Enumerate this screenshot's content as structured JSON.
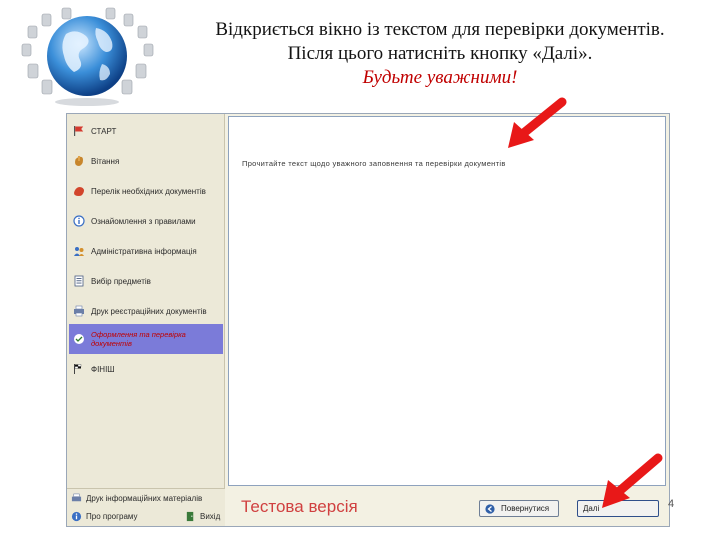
{
  "header": {
    "line1": "Відкриється вікно із текстом для перевірки документів.",
    "line2": "Після цього натисніть кнопку «Далі».",
    "line3": "Будьте уважними!"
  },
  "sidebar": {
    "items": [
      {
        "label": "СТАРТ",
        "icon": "flag-icon"
      },
      {
        "label": "Вітання",
        "icon": "hand-icon"
      },
      {
        "label": "Перелік необхідних документів",
        "icon": "hand-icon"
      },
      {
        "label": "Ознайомлення з правилами",
        "icon": "info-icon"
      },
      {
        "label": "Адміністративна інформація",
        "icon": "people-icon"
      },
      {
        "label": "Вибір предметів",
        "icon": "list-icon"
      },
      {
        "label": "Друк реєстраційних документів",
        "icon": "printer-icon"
      },
      {
        "label": "Оформлення та перевірка документів",
        "icon": "document-check-icon"
      },
      {
        "label": "ФІНІШ",
        "icon": "checkered-flag-icon"
      }
    ]
  },
  "content": {
    "text": "Прочитайте текст щодо уважного заповнення та перевірки документів"
  },
  "bottom_left": {
    "item1": "Друк інформаційних матеріалів",
    "item2": "Про програму",
    "item3": "Вихід"
  },
  "bottom_bar": {
    "test_version": "Тестова версія",
    "back_label": "Повернутися",
    "next_label": "Далі"
  },
  "page_number": "4",
  "colors": {
    "accent_red": "#c00000",
    "active_item": "#7b7bd9",
    "arrow": "#e81818"
  }
}
